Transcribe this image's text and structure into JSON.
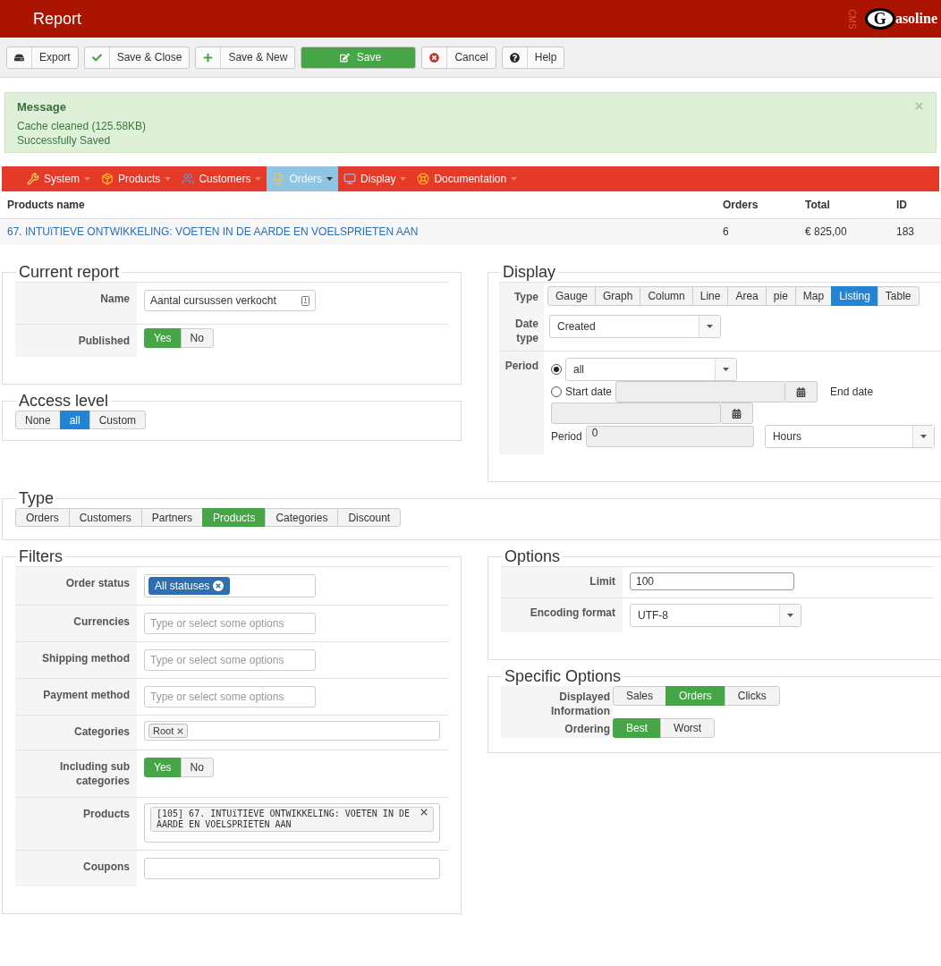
{
  "header": {
    "title": "Report",
    "tag": "CMS",
    "logo_letter": "G",
    "logo_text": "asoline"
  },
  "toolbar": [
    {
      "label": "Export",
      "kind": "default"
    },
    {
      "label": "Save & Close",
      "kind": "default"
    },
    {
      "label": "Save & New",
      "kind": "default"
    },
    {
      "label": "Save",
      "kind": "primary"
    },
    {
      "label": "Cancel",
      "kind": "default"
    },
    {
      "label": "Help",
      "kind": "default"
    }
  ],
  "message": {
    "title": "Message",
    "lines": [
      "Cache cleaned (125.58KB)",
      "Successfully Saved"
    ]
  },
  "menu": [
    {
      "label": "System",
      "selected": false
    },
    {
      "label": "Products",
      "selected": false
    },
    {
      "label": "Customers",
      "selected": false
    },
    {
      "label": "Orders",
      "selected": true
    },
    {
      "label": "Display",
      "selected": false
    },
    {
      "label": "Documentation",
      "selected": false
    }
  ],
  "table": {
    "columns": [
      "Products name",
      "Orders",
      "Total",
      "ID"
    ],
    "rows": [
      [
        "67. INTUïTIEVE ONTWIKKELING: VOETEN IN DE AARDE EN VOELSPRIETEN AAN",
        "6",
        "€ 825,00",
        "183"
      ]
    ]
  },
  "current_report": {
    "legend": "Current report",
    "name_label": "Name",
    "name_value": "Aantal cursussen verkocht",
    "published_label": "Published",
    "published": {
      "options": [
        {
          "label": "Yes",
          "selected": true
        },
        {
          "label": "No",
          "selected": false
        }
      ]
    }
  },
  "access_level": {
    "legend": "Access level",
    "group": {
      "options": [
        {
          "label": "None",
          "selected": false
        },
        {
          "label": "all",
          "selected": true
        },
        {
          "label": "Custom",
          "selected": false
        }
      ]
    }
  },
  "display": {
    "legend": "Display",
    "type_label": "Type",
    "type": {
      "options": [
        {
          "label": "Gauge",
          "selected": false
        },
        {
          "label": "Graph",
          "selected": false
        },
        {
          "label": "Column",
          "selected": false
        },
        {
          "label": "Line",
          "selected": false
        },
        {
          "label": "Area",
          "selected": false
        },
        {
          "label": "pie",
          "selected": false
        },
        {
          "label": "Map",
          "selected": false
        },
        {
          "label": "Listing",
          "selected": true
        },
        {
          "label": "Table",
          "selected": false
        }
      ]
    },
    "date_type_label": "Date type",
    "date_type": "Created",
    "period_label": "Period",
    "preset": {
      "selected": true,
      "value": "all"
    },
    "range": {
      "selected": false,
      "start_label": "Start date",
      "end_label": "End date"
    },
    "span_label": "Period",
    "span_value": "0",
    "span_unit": "Hours"
  },
  "type": {
    "legend": "Type",
    "group": {
      "options": [
        {
          "label": "Orders",
          "selected": false
        },
        {
          "label": "Customers",
          "selected": false
        },
        {
          "label": "Partners",
          "selected": false
        },
        {
          "label": "Products",
          "selected": true
        },
        {
          "label": "Categories",
          "selected": false
        },
        {
          "label": "Discount",
          "selected": false
        }
      ]
    }
  },
  "filters": {
    "legend": "Filters",
    "rows": [
      {
        "label": "Order status",
        "kind": "badges",
        "tags": [
          {
            "label": "All statuses"
          }
        ]
      },
      {
        "label": "Currencies",
        "kind": "multiselect",
        "placeholder": "Type or select some options"
      },
      {
        "label": "Shipping method",
        "kind": "multiselect",
        "placeholder": "Type or select some options"
      },
      {
        "label": "Payment method",
        "kind": "multiselect",
        "placeholder": "Type or select some options"
      },
      {
        "label": "Categories",
        "kind": "chips",
        "tags": [
          {
            "label": "Root"
          }
        ]
      },
      {
        "label": "Including sub categories",
        "kind": "toggle",
        "group": {
          "options": [
            {
              "label": "Yes",
              "selected": true
            },
            {
              "label": "No",
              "selected": false
            }
          ]
        }
      },
      {
        "label": "Products",
        "kind": "blocks",
        "tags": [
          {
            "label": "[105] 67. INTUïTIEVE ONTWIKKELING: VOETEN IN DE AARDE EN VOELSPRIETEN AAN"
          }
        ]
      },
      {
        "label": "Coupons",
        "kind": "text"
      }
    ]
  },
  "options": {
    "legend": "Options",
    "limit_label": "Limit",
    "limit": "100",
    "encoding_label": "Encoding format",
    "encoding": "UTF-8"
  },
  "specific": {
    "legend": "Specific Options",
    "rows": [
      {
        "label": "Displayed Information",
        "group": {
          "options": [
            {
              "label": "Sales",
              "selected": false
            },
            {
              "label": "Orders",
              "selected": true
            },
            {
              "label": "Clicks",
              "selected": false
            }
          ]
        }
      },
      {
        "label": "Ordering",
        "group": {
          "options": [
            {
              "label": "Best",
              "selected": true
            },
            {
              "label": "Worst",
              "selected": false
            }
          ]
        }
      }
    ]
  }
}
